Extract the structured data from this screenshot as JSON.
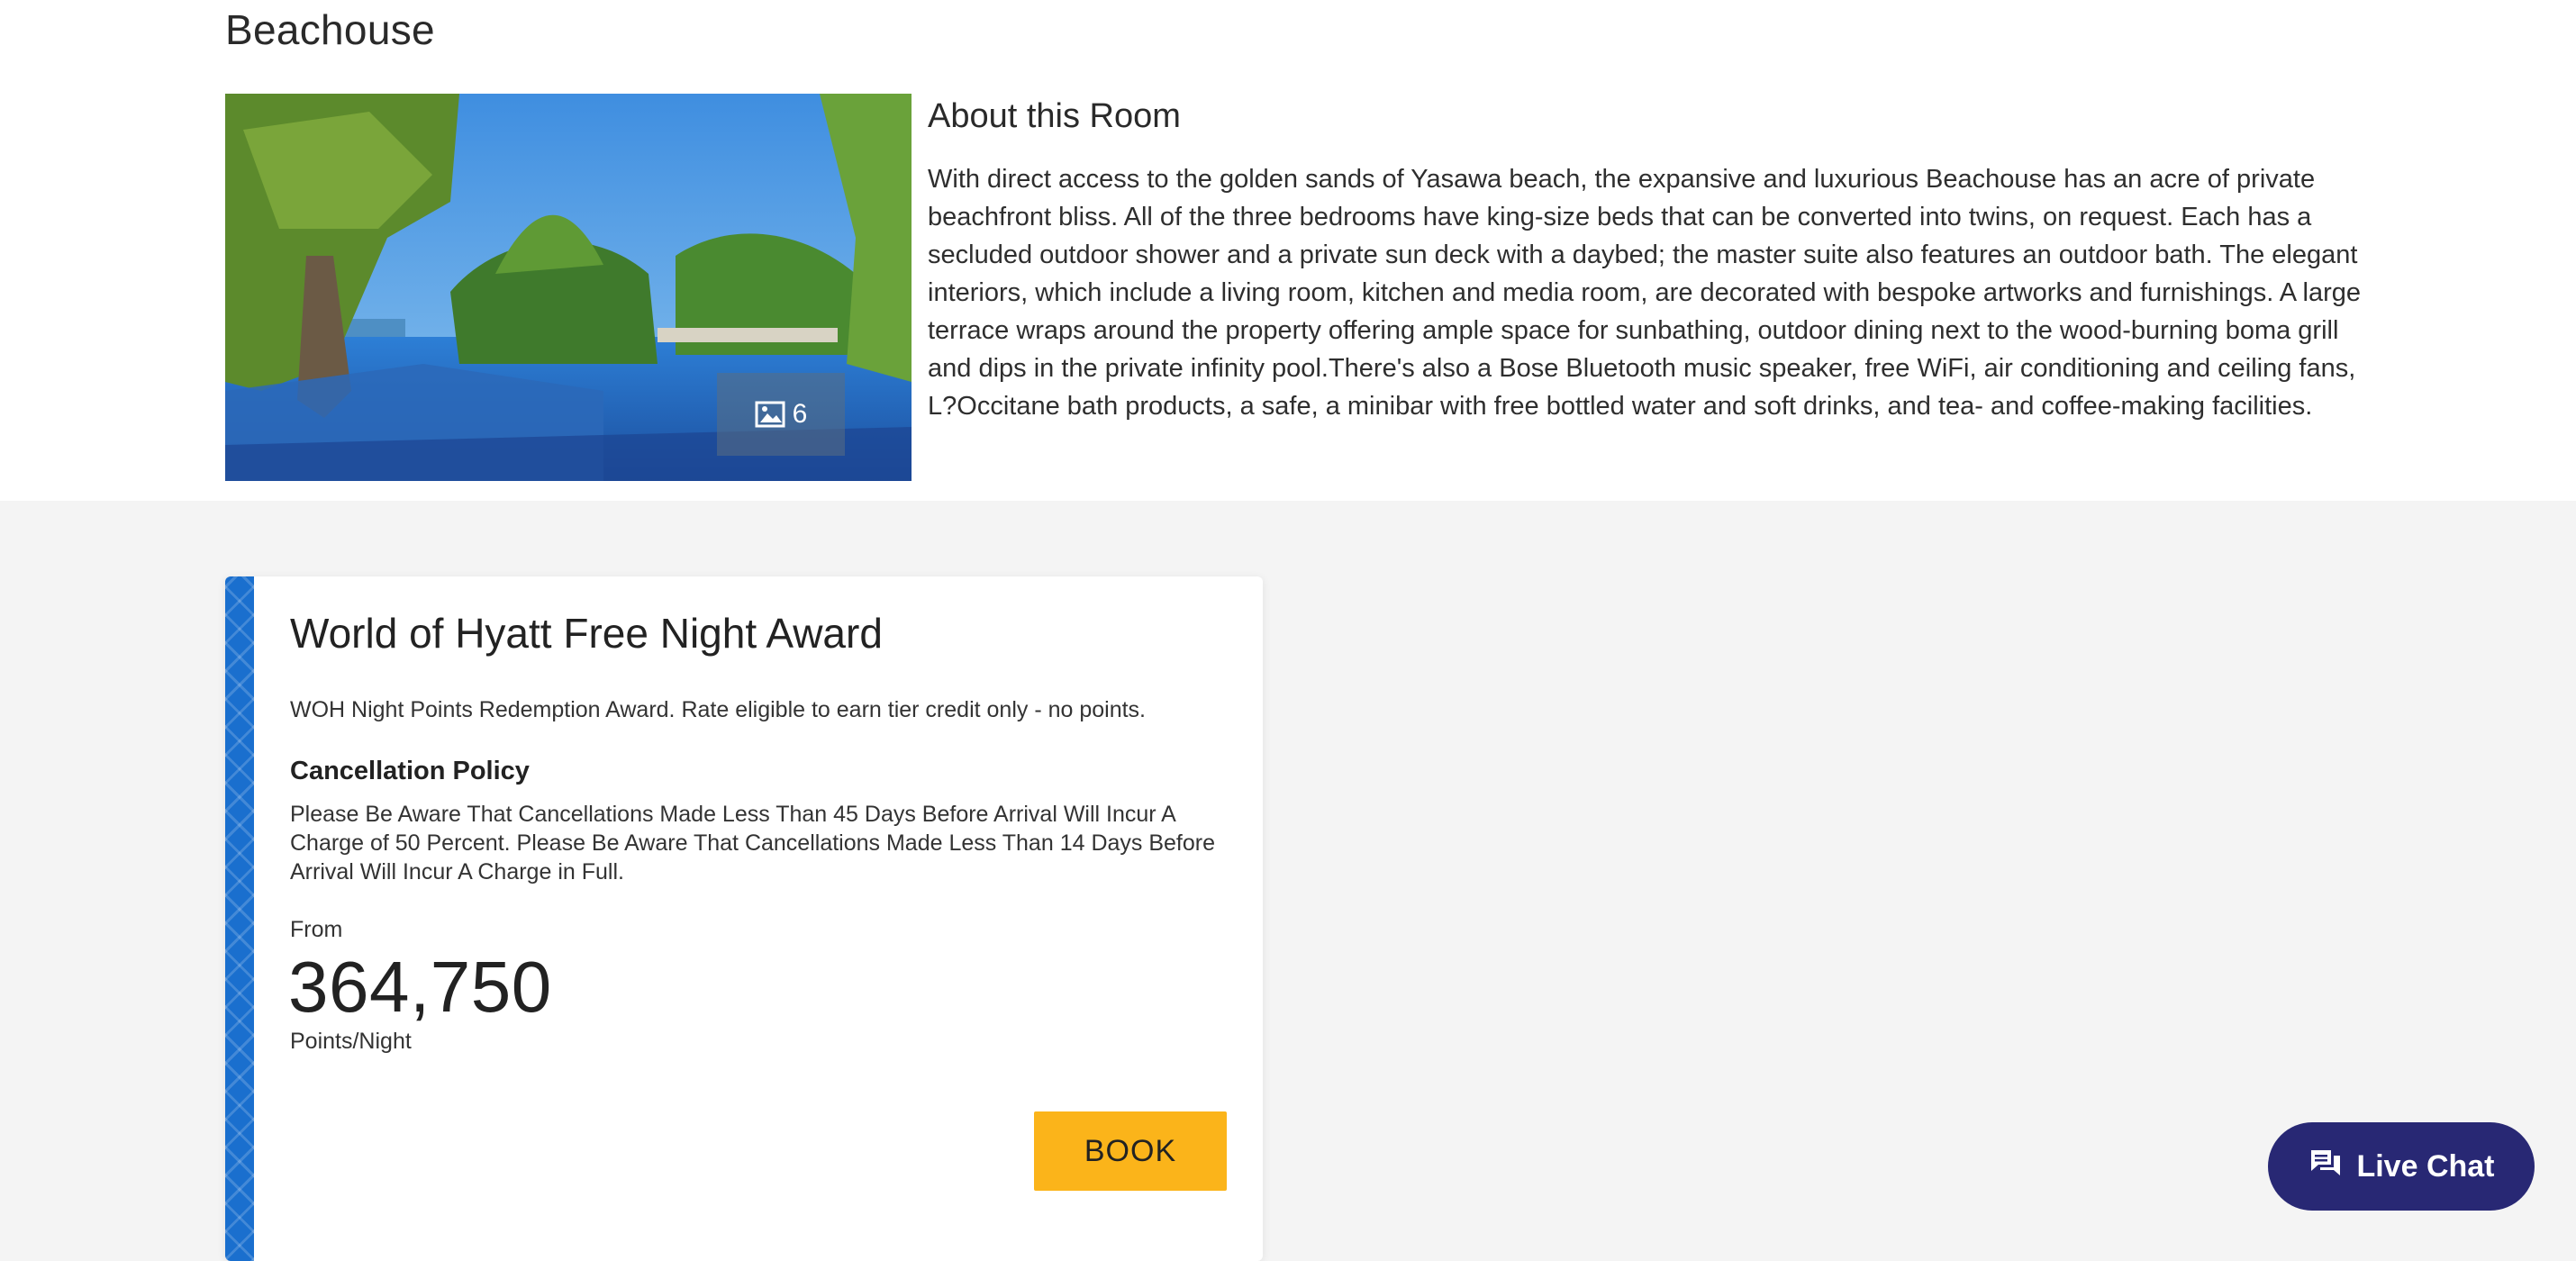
{
  "room": {
    "title": "Beachouse",
    "photo_count": "6",
    "about_heading": "About this Room",
    "about_text": "With direct access to the golden sands of Yasawa beach, the expansive and luxurious Beachouse has an acre of private beachfront bliss. All of the three bedrooms have king-size beds that can be converted into twins, on request. Each has a secluded outdoor shower and a private sun deck with a daybed; the master suite also features an outdoor bath. The elegant interiors, which include a living room, kitchen and media room, are decorated with bespoke artworks and furnishings. A large terrace wraps around the property offering ample space for sunbathing, outdoor dining next to the wood-burning boma grill and dips in the private infinity pool.There's also a Bose Bluetooth music speaker, free WiFi, air conditioning and ceiling fans, L?Occitane bath products, a safe, a minibar with free bottled water and soft drinks, and tea- and coffee-making facilities."
  },
  "rate": {
    "title": "World of Hyatt Free Night Award",
    "description": "WOH Night Points Redemption Award. Rate eligible to earn tier credit only - no points.",
    "cancellation_heading": "Cancellation Policy",
    "cancellation_text": "Please Be Aware That Cancellations Made Less Than 45 Days Before Arrival Will Incur A Charge of 50 Percent. Please Be Aware That Cancellations Made Less Than 14 Days Before Arrival Will Incur A Charge in Full.",
    "from_label": "From",
    "price": "364,750",
    "price_unit": "Points/Night",
    "book_label": "BOOK"
  },
  "chat": {
    "label": "Live Chat"
  },
  "colors": {
    "book_button": "#fbb41a",
    "chat_button": "#282874",
    "card_stripe": "#1a6fce"
  },
  "icons": {
    "gallery": "image-icon",
    "chat": "chat-bubble-icon"
  }
}
